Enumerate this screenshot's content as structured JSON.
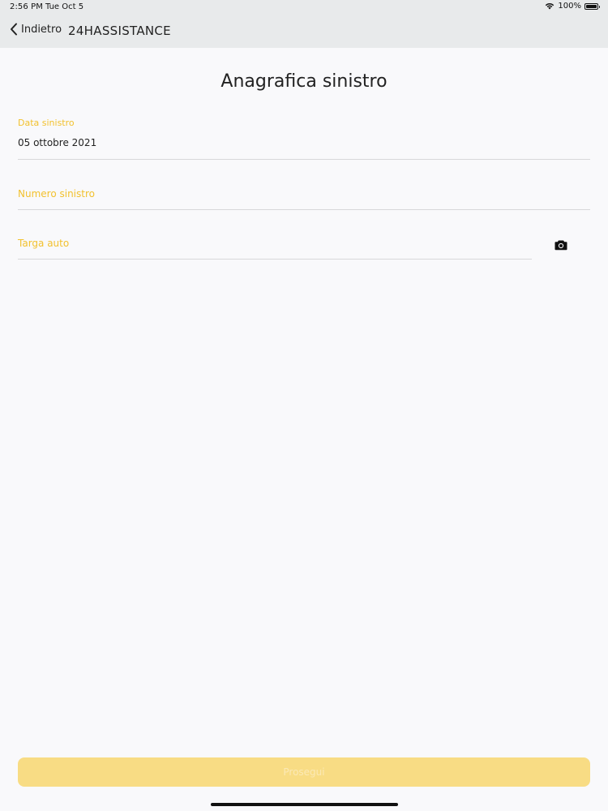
{
  "status_bar": {
    "time": "2:56 PM",
    "date": "Tue Oct 5",
    "battery": "100%",
    "wifi_icon": "wifi-icon",
    "battery_icon": "battery-icon"
  },
  "nav": {
    "back_label": "Indietro",
    "back_icon": "chevron-left-icon",
    "title": "24HASSISTANCE"
  },
  "page": {
    "title": "Anagrafica sinistro"
  },
  "form": {
    "claim_date": {
      "label": "Data sinistro",
      "value": "05 ottobre 2021"
    },
    "claim_number": {
      "placeholder": "Numero sinistro",
      "value": ""
    },
    "license_plate": {
      "placeholder": "Targa auto",
      "value": "",
      "scan_icon": "camera-icon"
    }
  },
  "actions": {
    "proceed_label": "Prosegui"
  },
  "colors": {
    "accent": "#f2c12e",
    "button_disabled": "#f8dc84",
    "topbar": "#e8eaeb",
    "background": "#f9f9fb"
  }
}
